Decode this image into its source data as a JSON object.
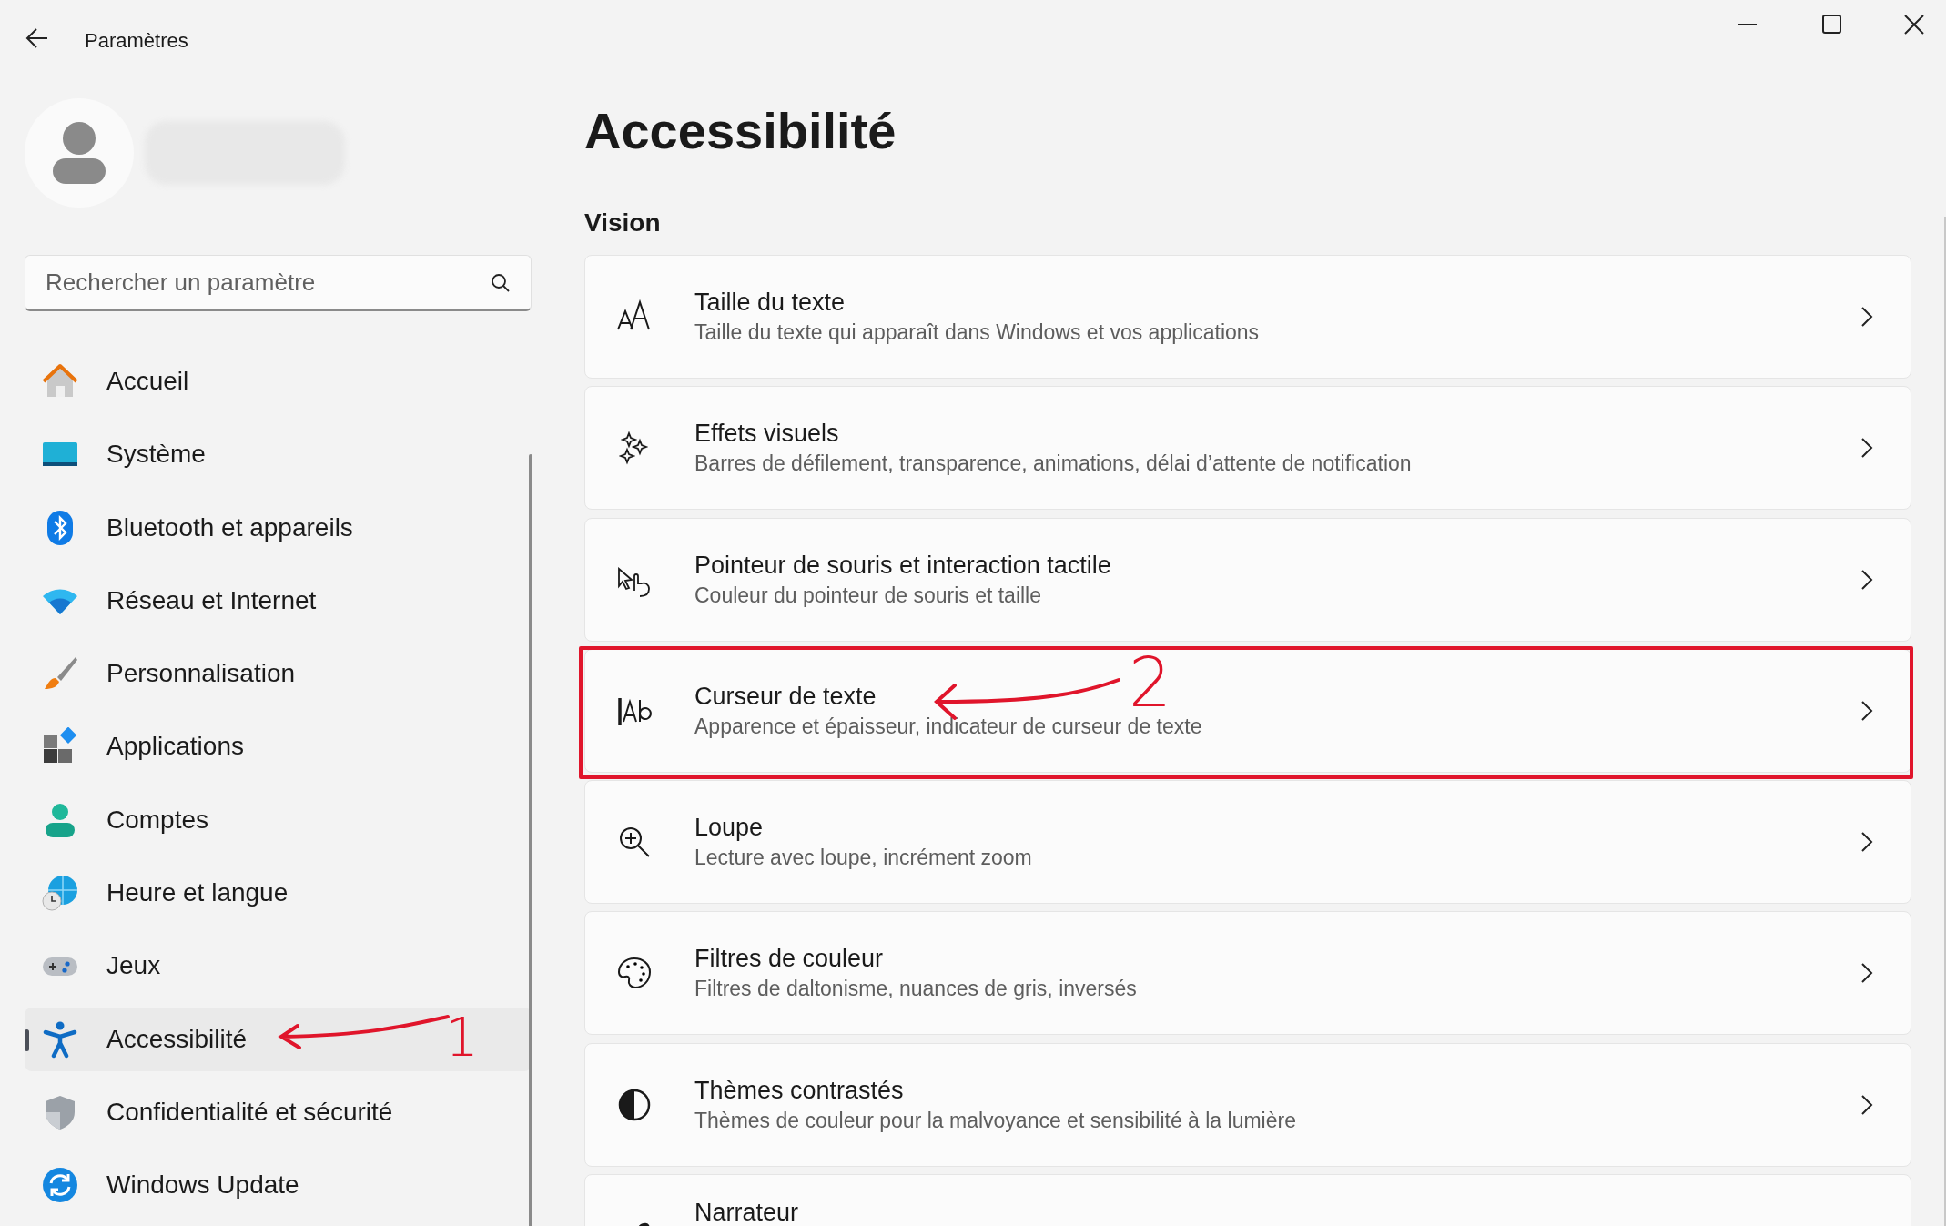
{
  "window": {
    "title": "Paramètres"
  },
  "search": {
    "placeholder": "Rechercher un paramètre"
  },
  "nav": [
    {
      "label": "Accueil",
      "selected": false
    },
    {
      "label": "Système",
      "selected": false
    },
    {
      "label": "Bluetooth et appareils",
      "selected": false
    },
    {
      "label": "Réseau et Internet",
      "selected": false
    },
    {
      "label": "Personnalisation",
      "selected": false
    },
    {
      "label": "Applications",
      "selected": false
    },
    {
      "label": "Comptes",
      "selected": false
    },
    {
      "label": "Heure et langue",
      "selected": false
    },
    {
      "label": "Jeux",
      "selected": false
    },
    {
      "label": "Accessibilité",
      "selected": true,
      "annotation": "1"
    },
    {
      "label": "Confidentialité et sécurité",
      "selected": false
    },
    {
      "label": "Windows Update",
      "selected": false
    }
  ],
  "page": {
    "title": "Accessibilité",
    "section": "Vision"
  },
  "cards": [
    {
      "title": "Taille du texte",
      "subtitle": "Taille du texte qui apparaît dans Windows et vos applications",
      "highlighted": false
    },
    {
      "title": "Effets visuels",
      "subtitle": "Barres de défilement, transparence, animations, délai d’attente de notification",
      "highlighted": false
    },
    {
      "title": "Pointeur de souris et interaction tactile",
      "subtitle": "Couleur du pointeur de souris et taille",
      "highlighted": false
    },
    {
      "title": "Curseur de texte",
      "subtitle": "Apparence et épaisseur, indicateur de curseur de texte",
      "highlighted": true,
      "annotation": "2"
    },
    {
      "title": "Loupe",
      "subtitle": "Lecture avec loupe, incrément zoom",
      "highlighted": false
    },
    {
      "title": "Filtres de couleur",
      "subtitle": "Filtres de daltonisme, nuances de gris, inversés",
      "highlighted": false
    },
    {
      "title": "Thèmes contrastés",
      "subtitle": "Thèmes de couleur pour la malvoyance et sensibilité à la lumière",
      "highlighted": false
    },
    {
      "title": "Narrateur",
      "highlighted": false
    }
  ]
}
